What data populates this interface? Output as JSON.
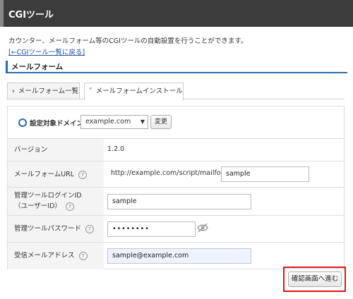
{
  "header": {
    "title": "CGIツール"
  },
  "description": "カウンター、メールフォーム等のCGIツールの自動設置を行うことができます。",
  "back_link": "[←CGIツール一覧に戻る]",
  "section_title": "メールフォーム",
  "tabs": [
    {
      "label": "メールフォーム一覧",
      "active": false
    },
    {
      "label": "メールフォームインストール",
      "active": true
    }
  ],
  "domain": {
    "label": "設定対象ドメイン",
    "selected": "example.com",
    "change_button": "変更"
  },
  "rows": {
    "version": {
      "label": "バージョン",
      "value": "1.2.0"
    },
    "url": {
      "label": "メールフォームURL",
      "prefix": "http://example.com/script/mailform/",
      "value": "sample"
    },
    "login": {
      "label_line1": "管理ツールログインID",
      "label_line2": "（ユーザーID）",
      "value": "sample"
    },
    "password": {
      "label": "管理ツールパスワード",
      "value": "••••••••"
    },
    "email": {
      "label": "受信メールアドレス",
      "value": "sample@example.com"
    }
  },
  "help_glyph": "?",
  "submit_button": "確認画面へ進む",
  "colors": {
    "header_bg": "#3c3c3c",
    "accent": "#2a6cb0",
    "highlight": "#e0141e"
  }
}
